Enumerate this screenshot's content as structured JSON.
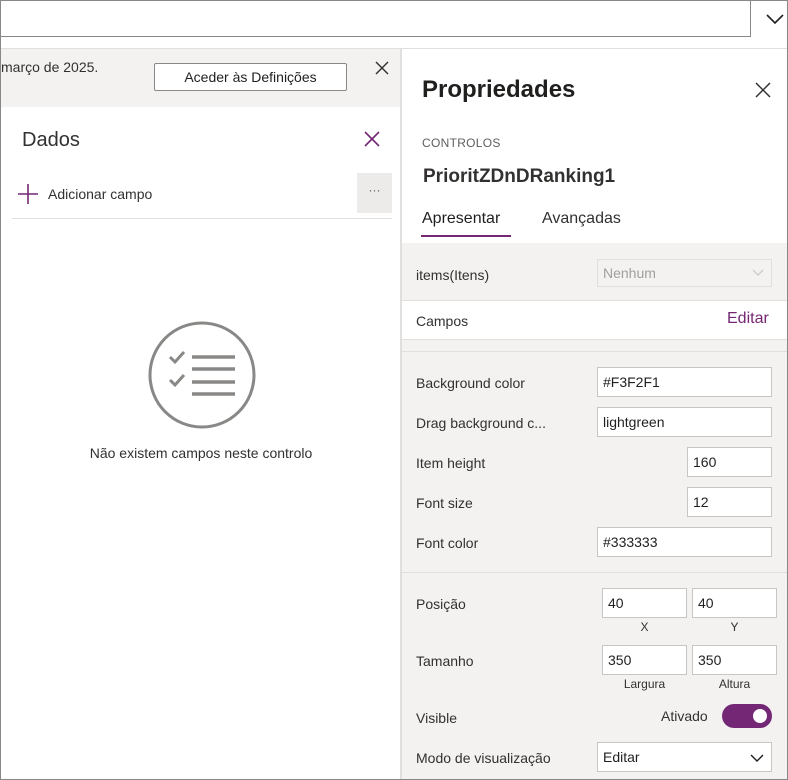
{
  "topbar": {
    "chevron_icon": "chevron-down-icon"
  },
  "banner": {
    "text": "março de 2025.",
    "button_label": "Aceder às Definições",
    "close_icon": "close-icon"
  },
  "data_pane": {
    "title": "Dados",
    "close_icon": "close-icon",
    "add_field_label": "Adicionar campo",
    "more_label": "···",
    "empty_message": "Não existem campos neste controlo",
    "empty_icon": "checklist-icon",
    "accent_color": "#742774"
  },
  "properties": {
    "title": "Propriedades",
    "section_caption": "CONTROLOS",
    "control_name": "PrioritZDnDRanking1",
    "tabs": [
      {
        "label": "Apresentar",
        "active": true
      },
      {
        "label": "Avançadas",
        "active": false
      }
    ],
    "items": {
      "label": "items(Itens)",
      "value": "Nenhum"
    },
    "fields": {
      "label": "Campos",
      "edit_label": "Editar"
    },
    "custom": [
      {
        "label": "Background color",
        "value": "#F3F2F1"
      },
      {
        "label": "Drag background c...",
        "value": "lightgreen"
      },
      {
        "label": "Item height",
        "value": "160"
      },
      {
        "label": "Font size",
        "value": "12"
      },
      {
        "label": "Font color",
        "value": "#333333"
      }
    ],
    "position": {
      "label": "Posição",
      "x": "40",
      "y": "40",
      "x_caption": "X",
      "y_caption": "Y"
    },
    "size": {
      "label": "Tamanho",
      "width": "350",
      "height": "350",
      "width_caption": "Largura",
      "height_caption": "Altura"
    },
    "visible": {
      "label": "Visible",
      "state_label": "Ativado",
      "on": true
    },
    "display_mode": {
      "label": "Modo de visualização",
      "value": "Editar"
    },
    "accent_color": "#742774"
  }
}
